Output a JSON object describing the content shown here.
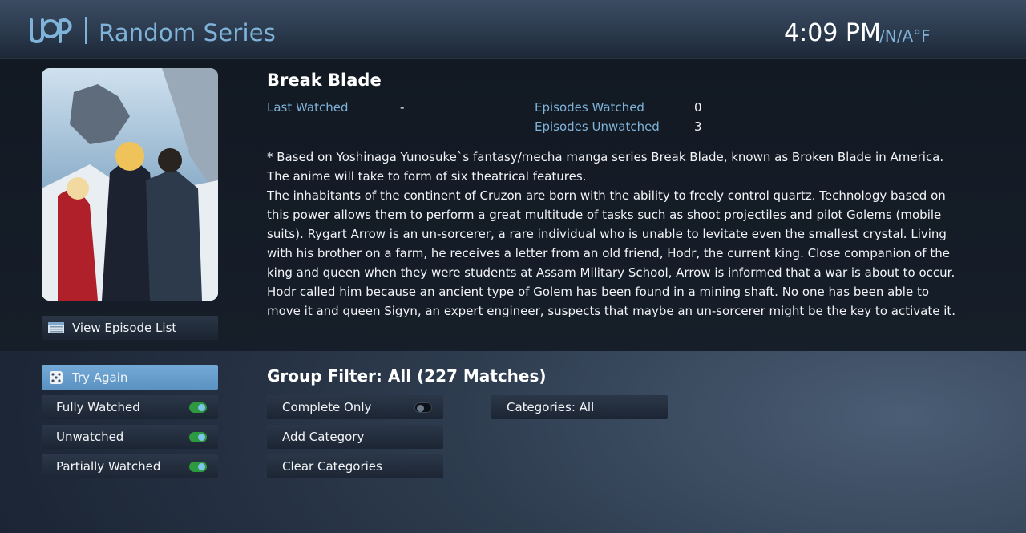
{
  "header": {
    "app_title": "Random Series",
    "clock": "4:09 PM",
    "weather": "/N/A°F",
    "logo_icon": "jmm-logo-icon"
  },
  "series": {
    "name": "Break Blade",
    "last_watched_label": "Last Watched",
    "last_watched_value": "-",
    "episodes_watched_label": "Episodes Watched",
    "episodes_watched_value": "0",
    "episodes_unwatched_label": "Episodes Unwatched",
    "episodes_unwatched_value": "3",
    "description": [
      "* Based on  Yoshinaga Yunosuke`s fantasy/mecha manga series Break Blade, known as Broken Blade in America. The anime will take to form of six theatrical features.",
      "The inhabitants of the continent of Cruzon are born with the ability to freely control quartz. Technology based on this power allows them to perform a great multitude of tasks such as shoot projectiles and pilot Golems (mobile suits). Rygart Arrow is an un-sorcerer, a rare individual who is unable to levitate even the smallest crystal. Living with his brother on a farm, he receives a letter from an old friend,  Hodr, the current king. Close companion of the king and queen when they were students at Assam Military School, Arrow is informed that a war is about to occur. Hodr called him because an ancient type of Golem has been found in a mining shaft. No one has been able to move it and queen  Sigyn, an expert engineer, suspects that maybe an un-sorcerer might be the key to activate it."
    ]
  },
  "actions": {
    "view_episode_list": "View Episode List",
    "try_again": "Try Again"
  },
  "filters": {
    "fully_watched": "Fully Watched",
    "unwatched": "Unwatched",
    "partially_watched": "Partially Watched",
    "fully_watched_on": true,
    "unwatched_on": true,
    "partially_watched_on": true
  },
  "group_filter": {
    "title": "Group Filter: All (227 Matches)",
    "complete_only": "Complete Only",
    "complete_only_on": false,
    "add_category": "Add Category",
    "clear_categories": "Clear Categories",
    "categories": "Categories: All"
  },
  "colors": {
    "accent": "#7fb3da",
    "active_button": "#6aa2d1",
    "toggle_on": "#2e9a3f"
  }
}
